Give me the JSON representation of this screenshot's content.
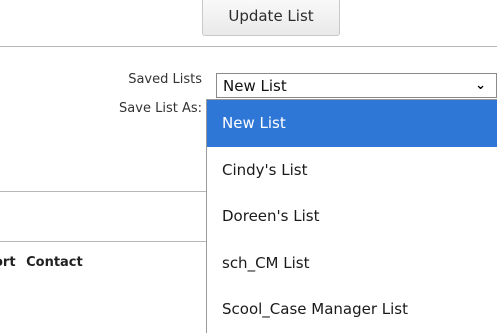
{
  "toolbar": {
    "update_label": "Update List"
  },
  "form": {
    "saved_lists_label": "Saved Lists",
    "save_as_label": "Save List As:",
    "selected_value": "New List"
  },
  "dropdown": {
    "options": [
      "New List",
      "Cindy's List",
      "Doreen's List",
      "sch_CM List",
      "Scool_Case Manager List"
    ]
  },
  "table": {
    "header_partial_1": "ort",
    "header_contact": "Contact"
  },
  "colors": {
    "selected_bg": "#2f77d6"
  }
}
